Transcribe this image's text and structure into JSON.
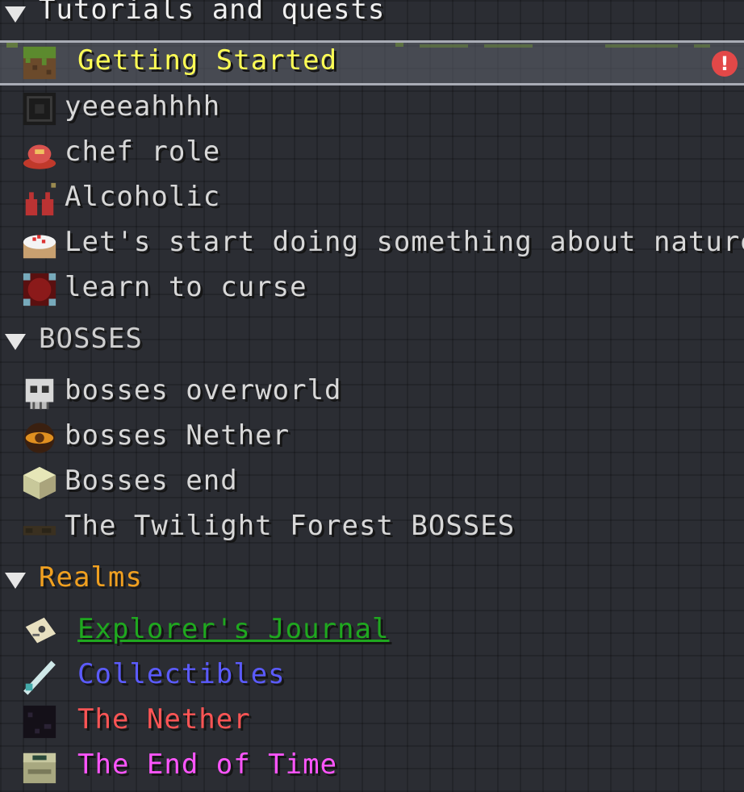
{
  "categories": {
    "tutorials": {
      "label": "Tutorials and quests",
      "color": "#f0f0f0"
    },
    "bosses": {
      "label": "BOSSES",
      "color": "#cfcfcf"
    },
    "realms": {
      "label": "Realms",
      "color": "#f0a020"
    }
  },
  "tutorials_items": [
    {
      "label": "Getting Started",
      "icon": "grass-block-icon",
      "color": "#ffff55",
      "selected": true,
      "alert": "!"
    },
    {
      "label": "yeeeahhhh",
      "icon": "dark-block-icon",
      "color": "#d8d8d8"
    },
    {
      "label": "chef role",
      "icon": "meat-dish-icon",
      "color": "#d8d8d8"
    },
    {
      "label": "Alcoholic",
      "icon": "bottles-icon",
      "color": "#d8d8d8"
    },
    {
      "label": "Let's start doing something about nature.",
      "icon": "cake-icon",
      "color": "#d8d8d8"
    },
    {
      "label": "learn to curse",
      "icon": "curse-block-icon",
      "color": "#d8d8d8"
    }
  ],
  "bosses_items": [
    {
      "label": "bosses overworld",
      "icon": "skull-icon",
      "color": "#d8d8d8"
    },
    {
      "label": "bosses Nether",
      "icon": "nether-boss-icon",
      "color": "#d8d8d8"
    },
    {
      "label": "Bosses end",
      "icon": "end-stone-icon",
      "color": "#d8d8d8"
    },
    {
      "label": "The Twilight Forest BOSSES",
      "icon": "twilight-log-icon",
      "color": "#d8d8d8"
    }
  ],
  "realms_items": [
    {
      "label": "Explorer's Journal",
      "icon": "journal-icon",
      "color": "#1fa81f",
      "underline": true
    },
    {
      "label": "Collectibles",
      "icon": "feather-icon",
      "color": "#5b5bff"
    },
    {
      "label": "The Nether",
      "icon": "obsidian-icon",
      "color": "#ff5555"
    },
    {
      "label": "The End of Time",
      "icon": "end-portal-icon",
      "color": "#ff55ff"
    }
  ]
}
